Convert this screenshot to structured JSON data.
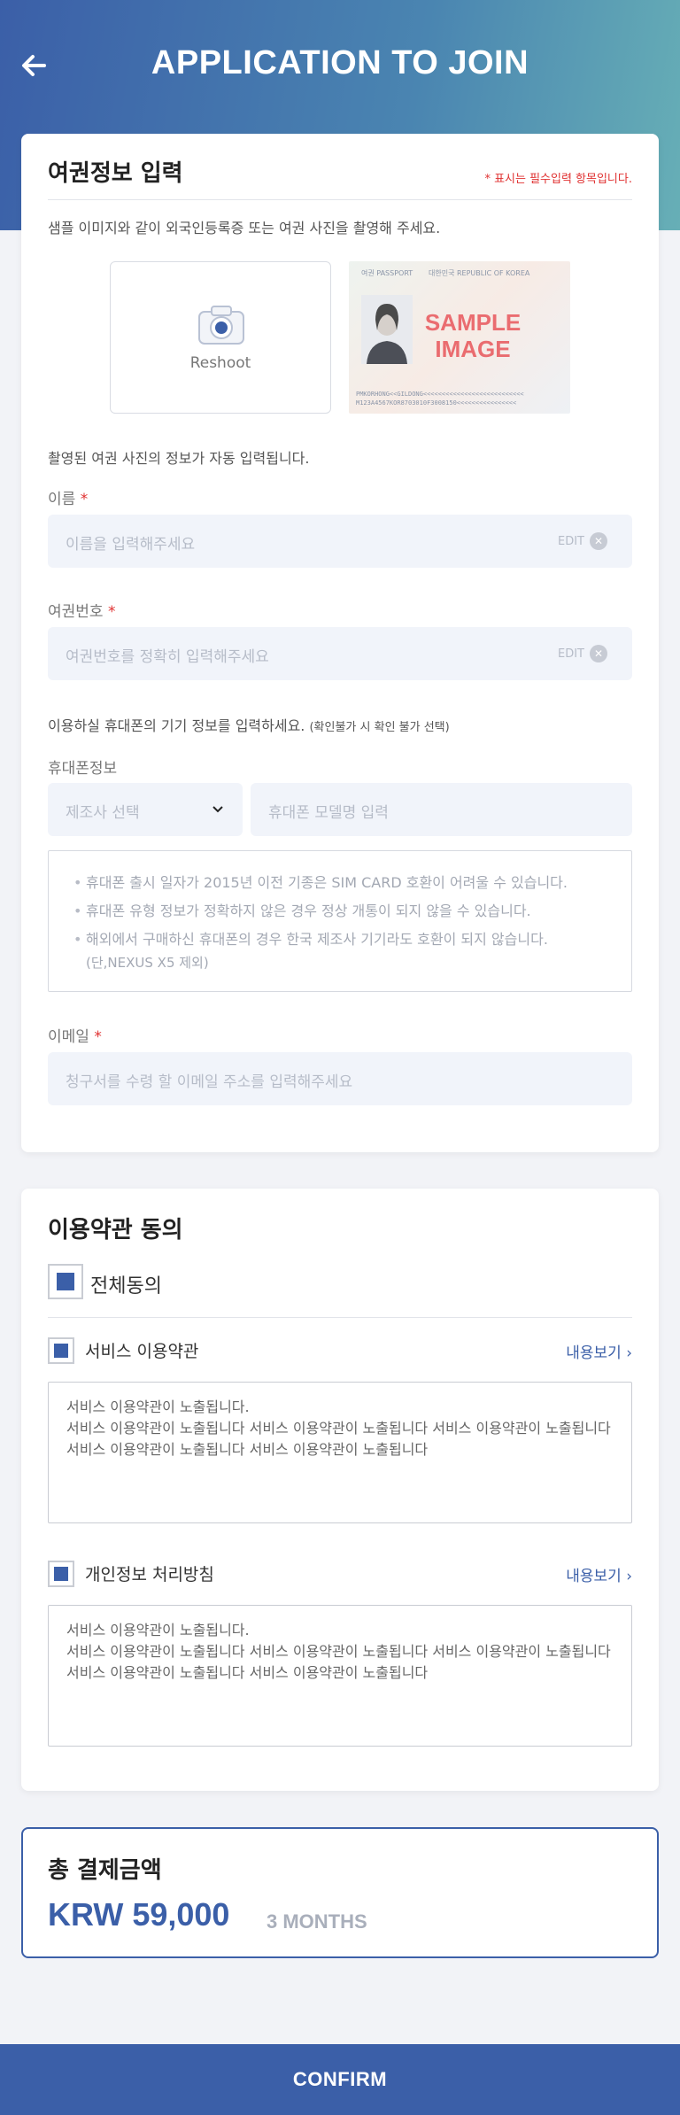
{
  "header": {
    "title": "APPLICATION TO JOIN",
    "back_icon": "arrow-left-icon"
  },
  "passport": {
    "title": "여권정보 입력",
    "required_note": "* 표시는 필수입력 항목입니다.",
    "instruction": "샘플 이미지와 같이 외국인등록증 또는 여권 사진을 촬영해 주세요.",
    "reshoot_label": "Reshoot",
    "sample_watermark_1": "SAMPLE",
    "sample_watermark_2": "IMAGE",
    "sample_header": "여권 PASSPORT",
    "sample_country": "대한민국 REPUBLIC OF KOREA",
    "sample_mrz_1": "PMKORHONG<<GILDONG<<<<<<<<<<<<<<<<<<<<<<<<<<<",
    "sample_mrz_2": "M123A4567KOR8703010F3008150<<<<<<<<<<<<<<<<",
    "auto_fill_note": "촬영된 여권 사진의 정보가 자동 입력됩니다.",
    "name_label": "이름",
    "name_placeholder": "이름을 입력해주세요",
    "passport_no_label": "여권번호",
    "passport_no_placeholder": "여권번호를 정확히 입력해주세요",
    "edit_label": "EDIT",
    "required_star": "*"
  },
  "device": {
    "instruction": "이용하실 휴대폰의 기기 정보를 입력하세요.",
    "instruction_small": "(확인불가 시 확인 불가 선택)",
    "label": "휴대폰정보",
    "manufacturer_placeholder": "제조사 선택",
    "model_placeholder": "휴대폰 모델명 입력",
    "notices": [
      "휴대폰 출시 일자가 2015년 이전 기종은 SIM CARD 호환이 어려울 수 있습니다.",
      "휴대폰 유형 정보가 정확하지 않은 경우 정상 개통이 되지 않을 수 있습니다.",
      "해외에서 구매하신 휴대폰의 경우 한국 제조사 기기라도 호환이 되지 않습니다."
    ],
    "notice_sub": "(단,NEXUS X5 제외)"
  },
  "email": {
    "label": "이메일",
    "placeholder": "청구서를 수령 할 이메일 주소를 입력해주세요"
  },
  "terms": {
    "title": "이용약관 동의",
    "agree_all": "전체동의",
    "view_label": "내용보기",
    "service_title": "서비스 이용약관",
    "service_text_1": "서비스 이용약관이 노출됩니다.",
    "service_text_2": "서비스 이용약관이 노출됩니다 서비스 이용약관이 노출됩니다 서비스 이용약관이 노출됩니다 서비스 이용약관이 노출됩니다 서비스 이용약관이 노출됩니다",
    "privacy_title": "개인정보 처리방침",
    "privacy_text_1": "서비스 이용약관이 노출됩니다.",
    "privacy_text_2": "서비스 이용약관이 노출됩니다 서비스 이용약관이 노출됩니다 서비스 이용약관이 노출됩니다 서비스 이용약관이 노출됩니다 서비스 이용약관이 노출됩니다",
    "agree_all_checked": true,
    "service_checked": true,
    "privacy_checked": true
  },
  "total": {
    "title": "총 결제금액",
    "amount": "KRW 59,000",
    "period": "3 MONTHS"
  },
  "confirm_label": "CONFIRM",
  "colors": {
    "primary": "#3b5fa8",
    "required": "#e03131",
    "field_bg": "#f1f4fa"
  }
}
